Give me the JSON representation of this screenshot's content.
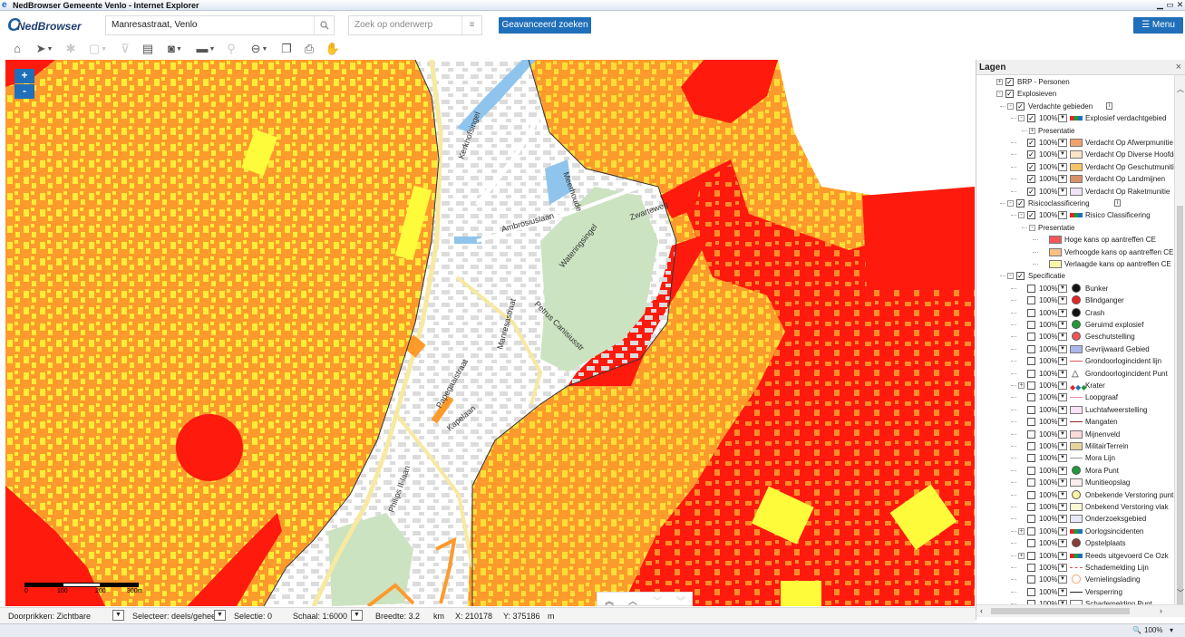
{
  "window": {
    "title": "NedBrowser Gemeente Venlo - Internet Explorer"
  },
  "app": {
    "logo_text": "NedBrowser"
  },
  "search": {
    "address_value": "Manresastraat, Venlo",
    "subject_placeholder": "Zoek op onderwerp",
    "advanced_label": "Geavanceerd zoeken",
    "menu_label": "Menu"
  },
  "map": {
    "zoom_in": "+",
    "zoom_out": "-",
    "scale_labels": [
      "0",
      "100",
      "200",
      "300m"
    ],
    "labels": [
      "Ambrosiuslaan",
      "Wateringsingel",
      "Zwarteweg",
      "Manresastraat",
      "Petrus Canisiusstr",
      "Papegaaistraat",
      "Kapelaan",
      "Philips II-laan",
      "Meerhoude",
      "Kerkhofsingel"
    ],
    "colors": {
      "red": "#fe1a0d",
      "orange": "#fd9a2c",
      "yellow": "#fefb3a",
      "park": "#cbe3c1",
      "water": "#8fc4ec",
      "building": "#dcdcdc",
      "road": "#ffffff",
      "road_main": "#f7e9a0"
    }
  },
  "layers_panel": {
    "title": "Lagen",
    "close": "×",
    "rows": [
      {
        "depth": 0,
        "exp": "+",
        "cb": true,
        "pct": "",
        "sym": "",
        "label": "BRP - Personen"
      },
      {
        "depth": 0,
        "exp": "-",
        "cb": true,
        "pct": "",
        "sym": "",
        "label": "Explosieven"
      },
      {
        "depth": 1,
        "exp": "-",
        "cb": true,
        "pct": "",
        "sym": "",
        "label": "Verdachte gebieden",
        "info": true
      },
      {
        "depth": 2,
        "exp": "-",
        "cb": true,
        "pct": "100%",
        "sym": "multi",
        "label": "Explosief verdachtgebied"
      },
      {
        "depth": 3,
        "exp": "+",
        "cb": null,
        "pct": "",
        "sym": "",
        "label": "Presentatie"
      },
      {
        "depth": 2,
        "exp": "",
        "cb": true,
        "pct": "100%",
        "sym": "fill:#f4a26c",
        "label": "Verdacht Op Afwerpmunitie"
      },
      {
        "depth": 2,
        "exp": "",
        "cb": true,
        "pct": "100%",
        "sym": "fill:#fbe5c8",
        "label": "Verdacht Op Diverse Hoofdgroepen"
      },
      {
        "depth": 2,
        "exp": "",
        "cb": true,
        "pct": "100%",
        "sym": "fill:#f7c26a",
        "label": "Verdacht Op Geschutmunitie"
      },
      {
        "depth": 2,
        "exp": "",
        "cb": true,
        "pct": "100%",
        "sym": "fill:#d9916a",
        "label": "Verdacht Op Landmijnen"
      },
      {
        "depth": 2,
        "exp": "",
        "cb": true,
        "pct": "100%",
        "sym": "fill:#f1e4f7",
        "label": "Verdacht Op Raketmunitie"
      },
      {
        "depth": 1,
        "exp": "-",
        "cb": true,
        "pct": "",
        "sym": "",
        "label": "Risicoclassificering",
        "info": true
      },
      {
        "depth": 2,
        "exp": "-",
        "cb": true,
        "pct": "100%",
        "sym": "multi",
        "label": "Risico Classificering"
      },
      {
        "depth": 3,
        "exp": "-",
        "cb": null,
        "pct": "",
        "sym": "",
        "label": "Presentatie"
      },
      {
        "depth": 4,
        "exp": "",
        "cb": null,
        "pct": "",
        "sym": "fill:#f4555a",
        "label": "Hoge kans op aantreffen CE"
      },
      {
        "depth": 4,
        "exp": "",
        "cb": null,
        "pct": "",
        "sym": "fill:#fbbf86",
        "label": "Verhoogde kans op aantreffen CE"
      },
      {
        "depth": 4,
        "exp": "",
        "cb": null,
        "pct": "",
        "sym": "fill:#fbf6a6",
        "label": "Verlaagde kans op aantreffen CE"
      },
      {
        "depth": 1,
        "exp": "-",
        "cb": true,
        "pct": "",
        "sym": "",
        "label": "Specificatie"
      },
      {
        "depth": 2,
        "exp": "",
        "cb": false,
        "pct": "100%",
        "sym": "dot:#111",
        "label": "Bunker"
      },
      {
        "depth": 2,
        "exp": "",
        "cb": false,
        "pct": "100%",
        "sym": "dot:#e8232a",
        "label": "Blindganger"
      },
      {
        "depth": 2,
        "exp": "",
        "cb": false,
        "pct": "100%",
        "sym": "dot:#111",
        "label": "Crash"
      },
      {
        "depth": 2,
        "exp": "",
        "cb": false,
        "pct": "100%",
        "sym": "dot:#1f9a3a",
        "label": "Geruimd explosief"
      },
      {
        "depth": 2,
        "exp": "",
        "cb": false,
        "pct": "100%",
        "sym": "dot:#ef5757",
        "label": "Geschutstelling"
      },
      {
        "depth": 2,
        "exp": "",
        "cb": false,
        "pct": "100%",
        "sym": "fill:#a9b7ee",
        "label": "Gevrijwaard Gebied"
      },
      {
        "depth": 2,
        "exp": "",
        "cb": false,
        "pct": "100%",
        "sym": "line:#e05656",
        "label": "Grondoorlogincident lijn"
      },
      {
        "depth": 2,
        "exp": "",
        "cb": false,
        "pct": "100%",
        "sym": "tri",
        "label": "Grondoorlogincident Punt"
      },
      {
        "depth": 2,
        "exp": "+",
        "cb": false,
        "pct": "100%",
        "sym": "dots",
        "label": "Krater"
      },
      {
        "depth": 2,
        "exp": "",
        "cb": false,
        "pct": "100%",
        "sym": "line:#e88aa8",
        "label": "Loopgraaf"
      },
      {
        "depth": 2,
        "exp": "",
        "cb": false,
        "pct": "100%",
        "sym": "fill:#fbe3f7",
        "label": "Luchtafweerstelling"
      },
      {
        "depth": 2,
        "exp": "",
        "cb": false,
        "pct": "100%",
        "sym": "line:#8a2b2b",
        "label": "Mangaten"
      },
      {
        "depth": 2,
        "exp": "",
        "cb": false,
        "pct": "100%",
        "sym": "fill:#fbdada",
        "label": "Mijnenveld"
      },
      {
        "depth": 2,
        "exp": "",
        "cb": false,
        "pct": "100%",
        "sym": "fill:#e7d39c",
        "label": "MilitairTerrein"
      },
      {
        "depth": 2,
        "exp": "",
        "cb": false,
        "pct": "100%",
        "sym": "line:#999999",
        "label": "Mora Lijn"
      },
      {
        "depth": 2,
        "exp": "",
        "cb": false,
        "pct": "100%",
        "sym": "dot:#1f9a3a",
        "label": "Mora Punt"
      },
      {
        "depth": 2,
        "exp": "",
        "cb": false,
        "pct": "100%",
        "sym": "fill:#fbeeee",
        "label": "Munitieopslag"
      },
      {
        "depth": 2,
        "exp": "",
        "cb": false,
        "pct": "100%",
        "sym": "dot:#fbf59e",
        "label": "Onbekende Verstoring punt"
      },
      {
        "depth": 2,
        "exp": "",
        "cb": false,
        "pct": "100%",
        "sym": "fill:#fbf9d2",
        "label": "Onbekend Verstoring vlak"
      },
      {
        "depth": 2,
        "exp": "",
        "cb": false,
        "pct": "100%",
        "sym": "fill:#e7e9fb",
        "label": "Onderzoeksgebied"
      },
      {
        "depth": 2,
        "exp": "+",
        "cb": false,
        "pct": "100%",
        "sym": "multi",
        "label": "Oorlogsincidenten"
      },
      {
        "depth": 2,
        "exp": "",
        "cb": false,
        "pct": "100%",
        "sym": "dot:#8a3b3b",
        "label": "Opstelplaats"
      },
      {
        "depth": 2,
        "exp": "+",
        "cb": false,
        "pct": "100%",
        "sym": "multi",
        "label": "Reeds uitgevoerd Ce Ozk"
      },
      {
        "depth": 2,
        "exp": "",
        "cb": false,
        "pct": "100%",
        "sym": "dash:#e05656",
        "label": "Schademelding Lijn"
      },
      {
        "depth": 2,
        "exp": "",
        "cb": false,
        "pct": "100%",
        "sym": "ring:#f4a26c",
        "label": "Vernielingslading"
      },
      {
        "depth": 2,
        "exp": "",
        "cb": false,
        "pct": "100%",
        "sym": "line:#222222",
        "label": "Versperring"
      },
      {
        "depth": 2,
        "exp": "",
        "cb": false,
        "pct": "100%",
        "sym": "fill:#ffffff",
        "label": "Schademelding Punt"
      }
    ]
  },
  "statusbar": {
    "doorprikken": "Doorprikken: Zichtbare",
    "selecteer": "Selecteer: deels/geheel",
    "selectie": "Selectie: 0",
    "schaal": "Schaal: 1:6000",
    "breedte": "Breedte: 3.2",
    "breedte_unit": "km",
    "x": "X: 210178",
    "y": "Y: 375186",
    "xy_unit": "m"
  },
  "ie": {
    "zoom": "100%"
  }
}
